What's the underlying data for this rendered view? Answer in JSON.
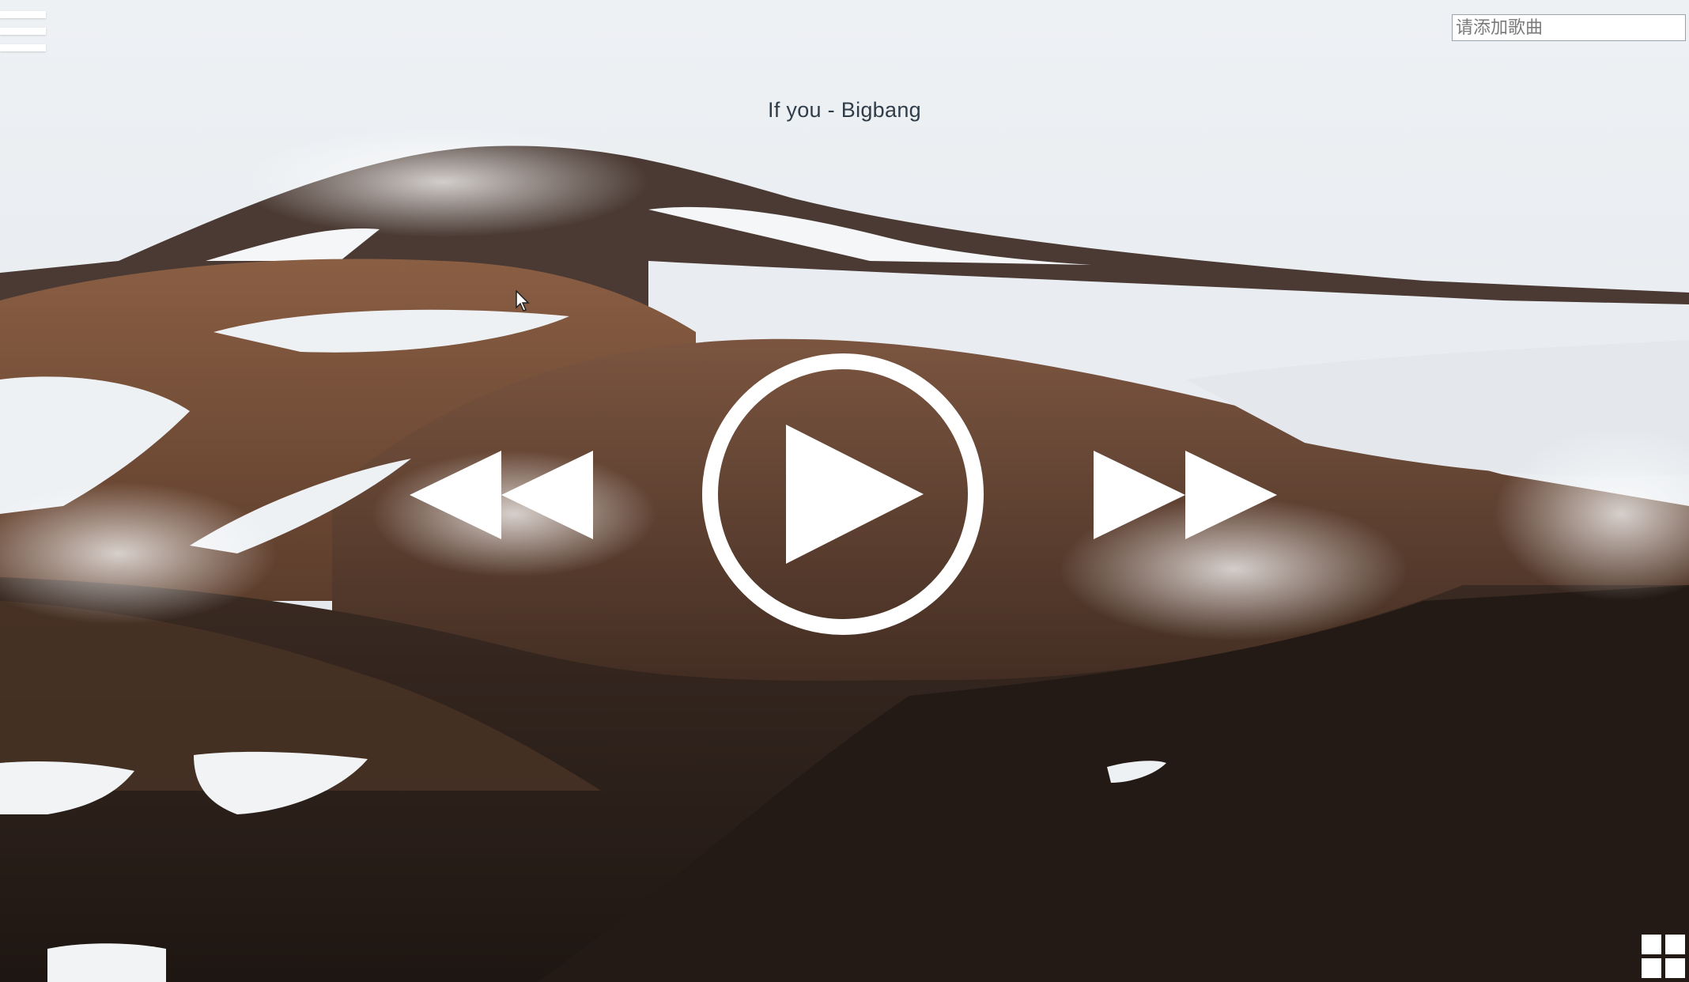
{
  "search": {
    "placeholder": "请添加歌曲"
  },
  "player": {
    "now_playing": "If you - Bigbang"
  },
  "controls": {
    "menu_icon": "hamburger-menu-icon",
    "prev_icon": "rewind-icon",
    "play_icon": "play-circle-icon",
    "next_icon": "fast-forward-icon",
    "grid_icon": "grid-view-icon"
  },
  "theme": {
    "icon_color": "#ffffff",
    "title_color": "#2f3d4a"
  }
}
